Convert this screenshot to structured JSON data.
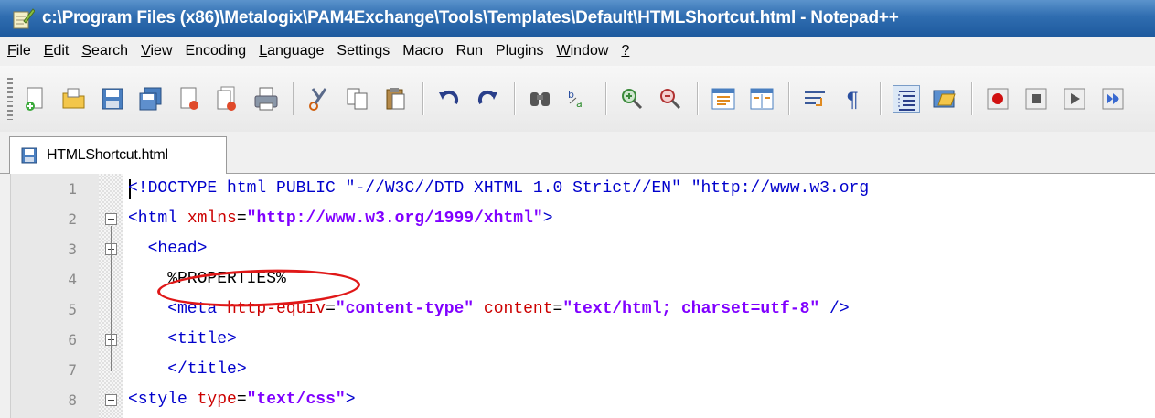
{
  "window": {
    "title": "c:\\Program Files (x86)\\Metalogix\\PAM4Exchange\\Tools\\Templates\\Default\\HTMLShortcut.html - Notepad++"
  },
  "menu": [
    {
      "label": "File",
      "mnemonic": "F",
      "rest": "ile"
    },
    {
      "label": "Edit",
      "mnemonic": "E",
      "rest": "dit"
    },
    {
      "label": "Search",
      "mnemonic": "S",
      "rest": "earch"
    },
    {
      "label": "View",
      "mnemonic": "V",
      "rest": "iew"
    },
    {
      "label": "Encoding",
      "mnemonic": "",
      "rest": "Encoding"
    },
    {
      "label": "Language",
      "mnemonic": "L",
      "rest": "anguage"
    },
    {
      "label": "Settings",
      "mnemonic": "",
      "rest": "Settings"
    },
    {
      "label": "Macro",
      "mnemonic": "",
      "rest": "Macro"
    },
    {
      "label": "Run",
      "mnemonic": "",
      "rest": "Run"
    },
    {
      "label": "Plugins",
      "mnemonic": "",
      "rest": "Plugins"
    },
    {
      "label": "Window",
      "mnemonic": "W",
      "rest": "indow"
    },
    {
      "label": "?",
      "mnemonic": "?",
      "rest": ""
    }
  ],
  "toolbar": {
    "icons": [
      "new-file-icon",
      "open-file-icon",
      "save-icon",
      "save-all-icon",
      "close-icon",
      "close-all-icon",
      "print-icon",
      "cut-icon",
      "copy-icon",
      "paste-icon",
      "undo-icon",
      "redo-icon",
      "find-icon",
      "replace-icon",
      "zoom-in-icon",
      "zoom-out-icon",
      "sync-vertical-icon",
      "sync-horizontal-icon",
      "word-wrap-icon",
      "show-all-chars-icon",
      "indent-guide-icon",
      "folder-as-workspace-icon",
      "record-macro-icon",
      "stop-record-icon",
      "play-macro-icon",
      "run-macro-multiple-icon"
    ]
  },
  "tab": {
    "label": "HTMLShortcut.html"
  },
  "editor": {
    "lines": [
      {
        "n": "1",
        "segments": [
          [
            "tag",
            "<!DOCTYPE html PUBLIC \"-//W3C//DTD XHTML 1.0 Strict//EN\" \"http://www.w3.org"
          ]
        ]
      },
      {
        "n": "2",
        "segments": [
          [
            "tag",
            "<html "
          ],
          [
            "attr",
            "xmlns"
          ],
          [
            "plain",
            "="
          ],
          [
            "str",
            "\"http://www.w3.org/1999/xhtml\""
          ],
          [
            "tag",
            ">"
          ]
        ]
      },
      {
        "n": "3",
        "segments": [
          [
            "tag",
            "  <head>"
          ]
        ]
      },
      {
        "n": "4",
        "segments": [
          [
            "plain",
            "    %PROPERTIES%"
          ]
        ]
      },
      {
        "n": "5",
        "segments": [
          [
            "tag",
            "    <meta "
          ],
          [
            "attr",
            "http-equiv"
          ],
          [
            "plain",
            "="
          ],
          [
            "str",
            "\"content-type\""
          ],
          [
            "plain",
            " "
          ],
          [
            "attr",
            "content"
          ],
          [
            "plain",
            "="
          ],
          [
            "str",
            "\"text/html; charset=utf-8\""
          ],
          [
            "tag",
            " />"
          ]
        ]
      },
      {
        "n": "6",
        "segments": [
          [
            "tag",
            "    <title>"
          ]
        ]
      },
      {
        "n": "7",
        "segments": [
          [
            "tag",
            "    </title>"
          ]
        ]
      },
      {
        "n": "8",
        "segments": [
          [
            "tag",
            "<style "
          ],
          [
            "attr",
            "type"
          ],
          [
            "plain",
            "="
          ],
          [
            "str",
            "\"text/css\""
          ],
          [
            "tag",
            ">"
          ]
        ]
      }
    ],
    "fold_lines": [
      "2",
      "3",
      "6",
      "8"
    ]
  },
  "colors": {
    "tag": "#0000cc",
    "attribute": "#cc0000",
    "string": "#8000ff",
    "annotation": "#e01818"
  }
}
